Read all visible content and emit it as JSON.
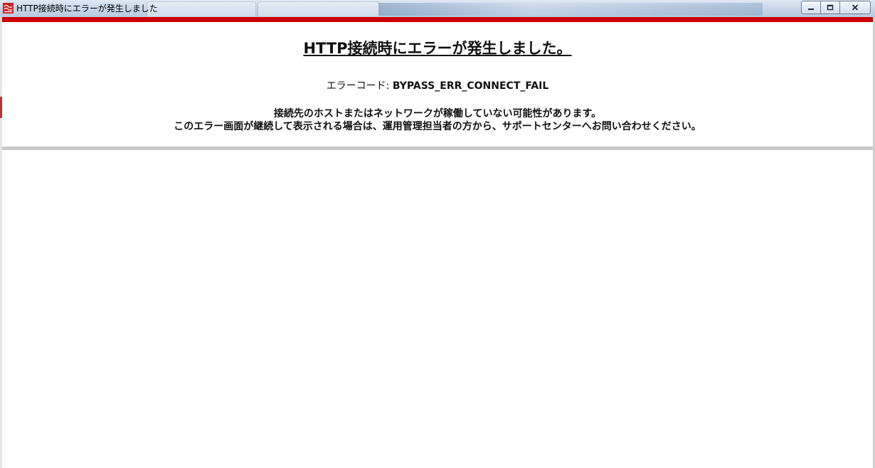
{
  "window": {
    "title": "HTTP接続時にエラーが発生しました",
    "controls": {
      "minimize_icon": "minimize-icon",
      "maximize_icon": "maximize-icon",
      "close_icon": "close-icon"
    }
  },
  "colors": {
    "accent_red": "#cc0000",
    "rule_gray": "#c8c8c8",
    "text": "#111111"
  },
  "error_page": {
    "heading": "HTTP接続時にエラーが発生しました。",
    "error_code_label": "エラーコード: ",
    "error_code": "BYPASS_ERR_CONNECT_FAIL",
    "message_line1": "接続先のホストまたはネットワークが稼働していない可能性があります。",
    "message_line2": "このエラー画面が継続して表示される場合は、運用管理担当者の方から、サポートセンターへお問い合わせください。"
  }
}
